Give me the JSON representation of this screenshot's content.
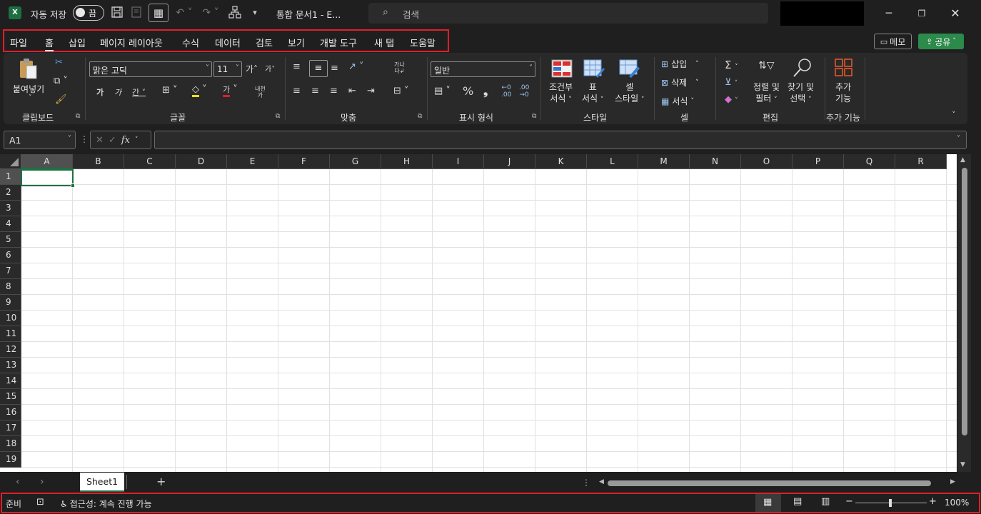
{
  "titlebar": {
    "app_icon": "X",
    "autosave_label": "자동 저장",
    "autosave_state": "끔",
    "doc_title": "통합 문서1  -  E...",
    "search_placeholder": "검색"
  },
  "menu": {
    "items": [
      "파일",
      "홈",
      "삽입",
      "페이지 레이아웃",
      "수식",
      "데이터",
      "검토",
      "보기",
      "개발 도구",
      "새 탭",
      "도움말"
    ],
    "active": "홈",
    "memo_label": "메모",
    "share_label": "공유"
  },
  "ribbon": {
    "clipboard": {
      "paste_label": "붙여넣기",
      "group_label": "클립보드"
    },
    "font": {
      "font_name": "맑은 고딕",
      "font_size": "11",
      "group_label": "글꼴"
    },
    "alignment": {
      "group_label": "맞춤"
    },
    "number": {
      "format": "일반",
      "group_label": "표시 형식"
    },
    "styles": {
      "cond_format_l1": "조건부",
      "cond_format_l2": "서식",
      "table_l1": "표",
      "table_l2": "서식",
      "cell_l1": "셀",
      "cell_l2": "스타일",
      "group_label": "스타일"
    },
    "cells": {
      "insert": "삽입",
      "delete": "삭제",
      "format": "서식",
      "group_label": "셀"
    },
    "editing": {
      "sort_l1": "정렬 및",
      "sort_l2": "필터",
      "find_l1": "찾기 및",
      "find_l2": "선택",
      "group_label": "편집"
    },
    "addins": {
      "l1": "추가",
      "l2": "기능",
      "group_label": "추가 기능"
    }
  },
  "formula_bar": {
    "name_box": "A1",
    "formula": ""
  },
  "grid": {
    "columns": [
      "A",
      "B",
      "C",
      "D",
      "E",
      "F",
      "G",
      "H",
      "I",
      "J",
      "K",
      "L",
      "M",
      "N",
      "O",
      "P",
      "Q",
      "R"
    ],
    "rows": [
      "1",
      "2",
      "3",
      "4",
      "5",
      "6",
      "7",
      "8",
      "9",
      "10",
      "11",
      "12",
      "13",
      "14",
      "15",
      "16",
      "17",
      "18",
      "19"
    ],
    "selected_column": "A",
    "selected_row": "1"
  },
  "sheets": {
    "tabs": [
      "Sheet1"
    ],
    "active": "Sheet1"
  },
  "status": {
    "ready": "준비",
    "accessibility": "접근성: 계속 진행 가능",
    "zoom": "100%"
  },
  "colors": {
    "accent": "#1e7145",
    "highlight_box": "#e01f2a",
    "share": "#2c8a4a"
  }
}
